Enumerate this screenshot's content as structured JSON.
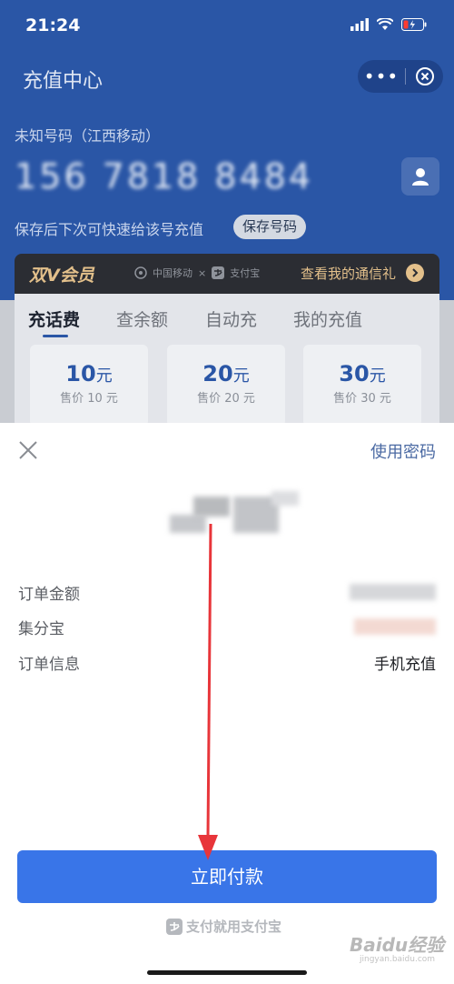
{
  "status_bar": {
    "time": "21:24"
  },
  "header": {
    "title": "充值中心",
    "more_label": "•••"
  },
  "account": {
    "carrier": "未知号码（江西移动）",
    "phone": "156 7818 8484",
    "save_tip": "保存后下次可快速给该号充值",
    "save_button": "保存号码"
  },
  "vip": {
    "title": "双V会员",
    "logo_left": "中国移动",
    "logo_right": "支付宝",
    "link": "查看我的通信礼"
  },
  "tabs": [
    {
      "label": "充话费",
      "active": true
    },
    {
      "label": "查余额",
      "active": false
    },
    {
      "label": "自动充",
      "active": false
    },
    {
      "label": "我的充值",
      "active": false
    }
  ],
  "amounts": [
    {
      "value": "10",
      "unit": "元",
      "price": "售价 10 元"
    },
    {
      "value": "20",
      "unit": "元",
      "price": "售价 20 元"
    },
    {
      "value": "30",
      "unit": "元",
      "price": "售价 30 元"
    }
  ],
  "payment_sheet": {
    "use_password": "使用密码",
    "rows": [
      {
        "label": "订单金额",
        "value": ""
      },
      {
        "label": "集分宝",
        "value": ""
      },
      {
        "label": "订单信息",
        "value": "手机充值"
      }
    ],
    "pay_button": "立即付款",
    "footer_brand": "支付就用支付宝"
  },
  "watermark": {
    "text": "Baidu经验",
    "sub": "jingyan.baidu.com"
  },
  "colors": {
    "header_blue": "#2a56a6",
    "pay_button": "#3975e8",
    "vip_gold": "#e3c08b",
    "annotation_arrow": "#e8353a"
  }
}
